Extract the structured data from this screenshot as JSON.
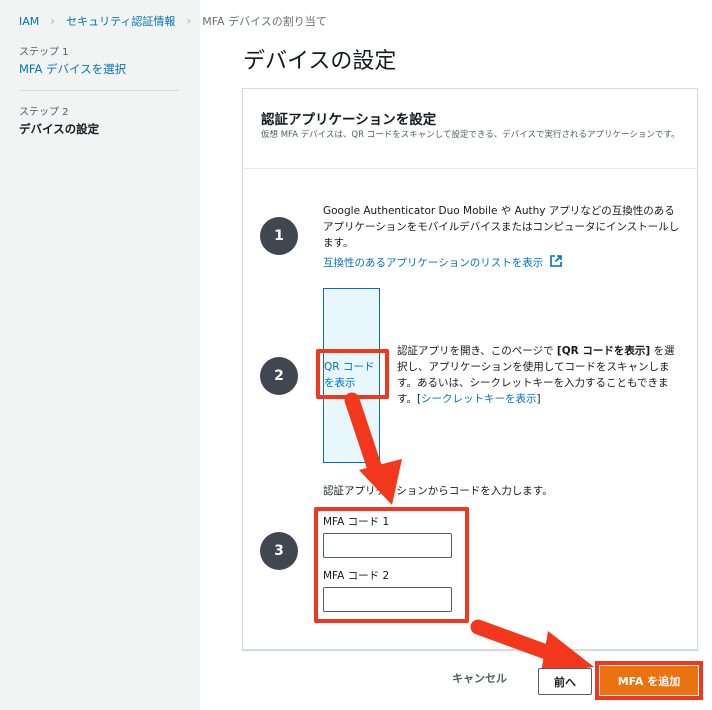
{
  "breadcrumb": [
    "IAM",
    "セキュリティ認証情報",
    "MFA デバイスの割り当て"
  ],
  "sidebar": {
    "steps": [
      {
        "caption": "ステップ 1",
        "label": "MFA デバイスを選択"
      },
      {
        "caption": "ステップ 2",
        "label": "デバイスの設定"
      }
    ]
  },
  "page_title": "デバイスの設定",
  "panel": {
    "title": "認証アプリケーションを設定",
    "description": "仮想 MFA デバイスは、QR コードをスキャンして設定できる、デバイスで実行されるアプリケーションです。",
    "step1": {
      "number": "1",
      "text": "Google Authenticator Duo Mobile や Authy アプリなどの互換性のあるアプリケーションをモバイルデバイスまたはコンピュータにインストールします。",
      "link": "互換性のあるアプリケーションのリストを表示"
    },
    "step2": {
      "number": "2",
      "qr_link": "QR コードを表示",
      "text_a": "認証アプリを開き、このページで",
      "bold": "[QR コードを表示]",
      "text_b": "を選択し、アプリケーションを使用してコードをスキャンします。あるいは、シークレットキーを入力することもできます。[",
      "secret_link": "シークレットキーを表示",
      "text_c": "]"
    },
    "step3": {
      "number": "3",
      "intro": "認証アプリケーションからコードを入力します。",
      "code1_label": "MFA コード 1",
      "code1_value": "",
      "code2_label": "MFA コード 2",
      "code2_value": ""
    }
  },
  "footer": {
    "cancel": "キャンセル",
    "previous": "前へ",
    "add_mfa": "MFA を追加"
  },
  "colors": {
    "accent": "#ec7211",
    "link": "#0073bb",
    "highlight": "#f2371d"
  },
  "icons": [
    "chevron-right-icon",
    "external-link-icon"
  ]
}
